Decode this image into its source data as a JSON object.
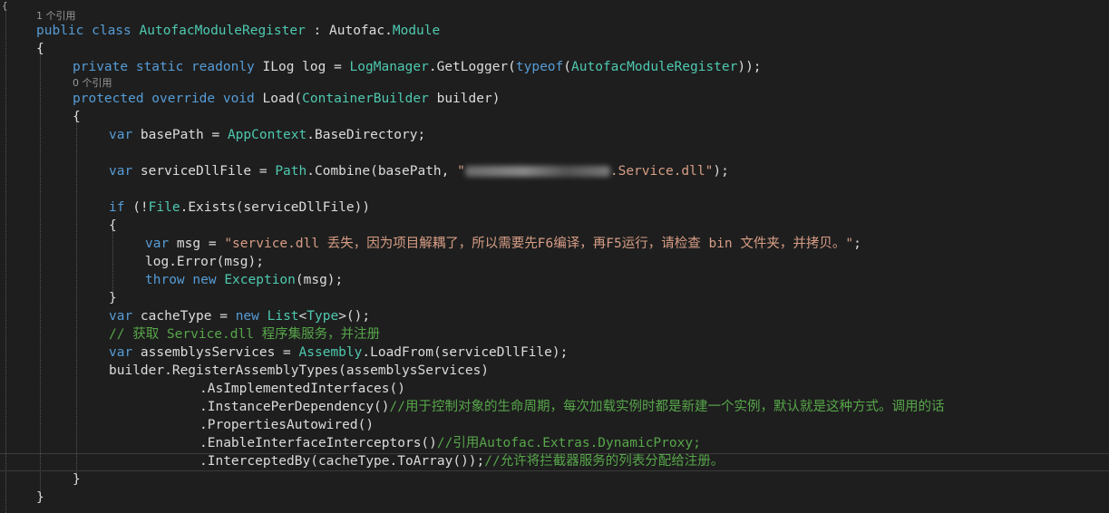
{
  "codelens": {
    "class_refs": "1 个引用",
    "load_refs": "0 个引用"
  },
  "code": {
    "l1": {
      "a": "public class ",
      "b": "AutofacModuleRegister",
      "c": " : Autofac.",
      "d": "Module"
    },
    "l2": "{",
    "l3": {
      "a": "private static readonly ",
      "b": "ILog log = ",
      "c": "LogManager",
      "d": ".GetLogger(",
      "e": "typeof",
      "f": "(",
      "g": "AutofacModuleRegister",
      "h": "));"
    },
    "l4": {
      "a": "protected override void ",
      "b": "Load(",
      "c": "ContainerBuilder",
      "d": " builder)"
    },
    "l5": "{",
    "l6": {
      "a": "var ",
      "b": "basePath = ",
      "c": "AppContext",
      "d": ".BaseDirectory;"
    },
    "l7": {
      "a": "var ",
      "b": "serviceDllFile = ",
      "c": "Path",
      "d": ".Combine(basePath, ",
      "e": "\"",
      "f": ".Service.dll\"",
      "g": ");"
    },
    "l8": {
      "a": "if ",
      "b": "(!",
      "c": "File",
      "d": ".Exists(serviceDllFile))"
    },
    "l9": "{",
    "l10": {
      "a": "var ",
      "b": "msg = ",
      "c": "\"service.dll 丢失，因为项目解耦了，所以需要先F6编译，再F5运行，请检查 bin 文件夹，并拷贝。\"",
      "d": ";"
    },
    "l11": {
      "a": "log.",
      "b": "Error",
      "c": "(msg);"
    },
    "l12": {
      "a": "throw new ",
      "b": "Exception",
      "c": "(msg);"
    },
    "l13": "}",
    "l14": {
      "a": "var ",
      "b": "cacheType = ",
      "c": "new ",
      "d": "List",
      "e": "<",
      "f": "Type",
      "g": ">();"
    },
    "l15": "// 获取 Service.dll 程序集服务，并注册",
    "l16": {
      "a": "var ",
      "b": "assemblysServices = ",
      "c": "Assembly",
      "d": ".LoadFrom(serviceDllFile);"
    },
    "l17": "builder.RegisterAssemblyTypes(assemblysServices)",
    "l18": ".AsImplementedInterfaces()",
    "l19": {
      "a": ".InstancePerDependency()",
      "b": "//用于控制对象的生命周期，每次加载实例时都是新建一个实例，默认就是这种方式。调用的话"
    },
    "l20": ".PropertiesAutowired()",
    "l21": {
      "a": ".EnableInterfaceInterceptors()",
      "b": "//引用Autofac.Extras.DynamicProxy;"
    },
    "l22": {
      "a": ".InterceptedBy(cacheType.ToArray());",
      "b": "//允许将拦截器服务的列表分配给注册。"
    },
    "l23": "}",
    "l24": "}"
  },
  "colors": {
    "background": "#1e1e1e",
    "keyword": "#569cd6",
    "type": "#4ec9b0",
    "string": "#d69d85",
    "comment": "#57a64a",
    "plain": "#dcdcdc"
  }
}
